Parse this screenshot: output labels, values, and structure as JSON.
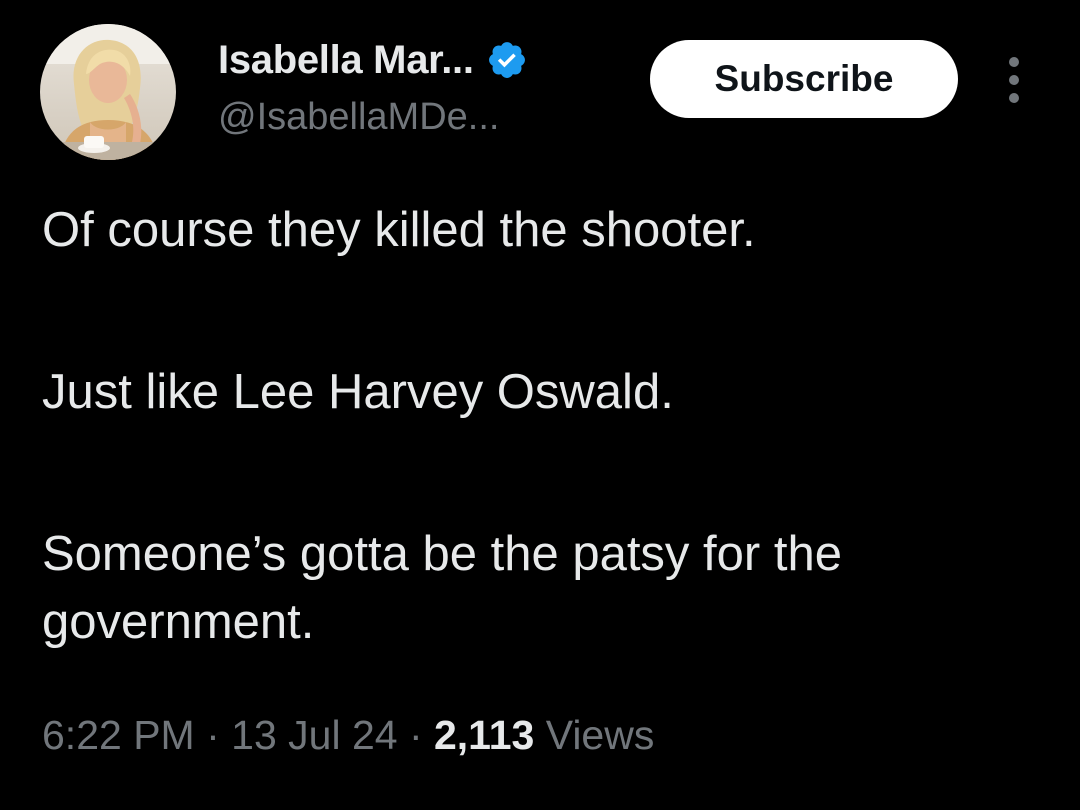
{
  "author": {
    "display_name": "Isabella Mar...",
    "handle": "@IsabellaMDe...",
    "verified_icon": "verified-badge-icon"
  },
  "actions": {
    "subscribe_label": "Subscribe",
    "more_icon": "more-vertical-icon"
  },
  "tweet": {
    "paragraphs": [
      "Of course they killed the shooter.",
      "Just like Lee Harvey Oswald.",
      "Someone’s gotta be the patsy for the government."
    ],
    "time": "6:22 PM",
    "separator": " · ",
    "date": "13 Jul 24",
    "view_count": "2,113",
    "views_label": " Views"
  },
  "colors": {
    "background": "#000000",
    "primary_text": "#e7e9ea",
    "secondary_text": "#71767b",
    "verified_blue": "#1d9bf0",
    "button_bg": "#ffffff"
  }
}
